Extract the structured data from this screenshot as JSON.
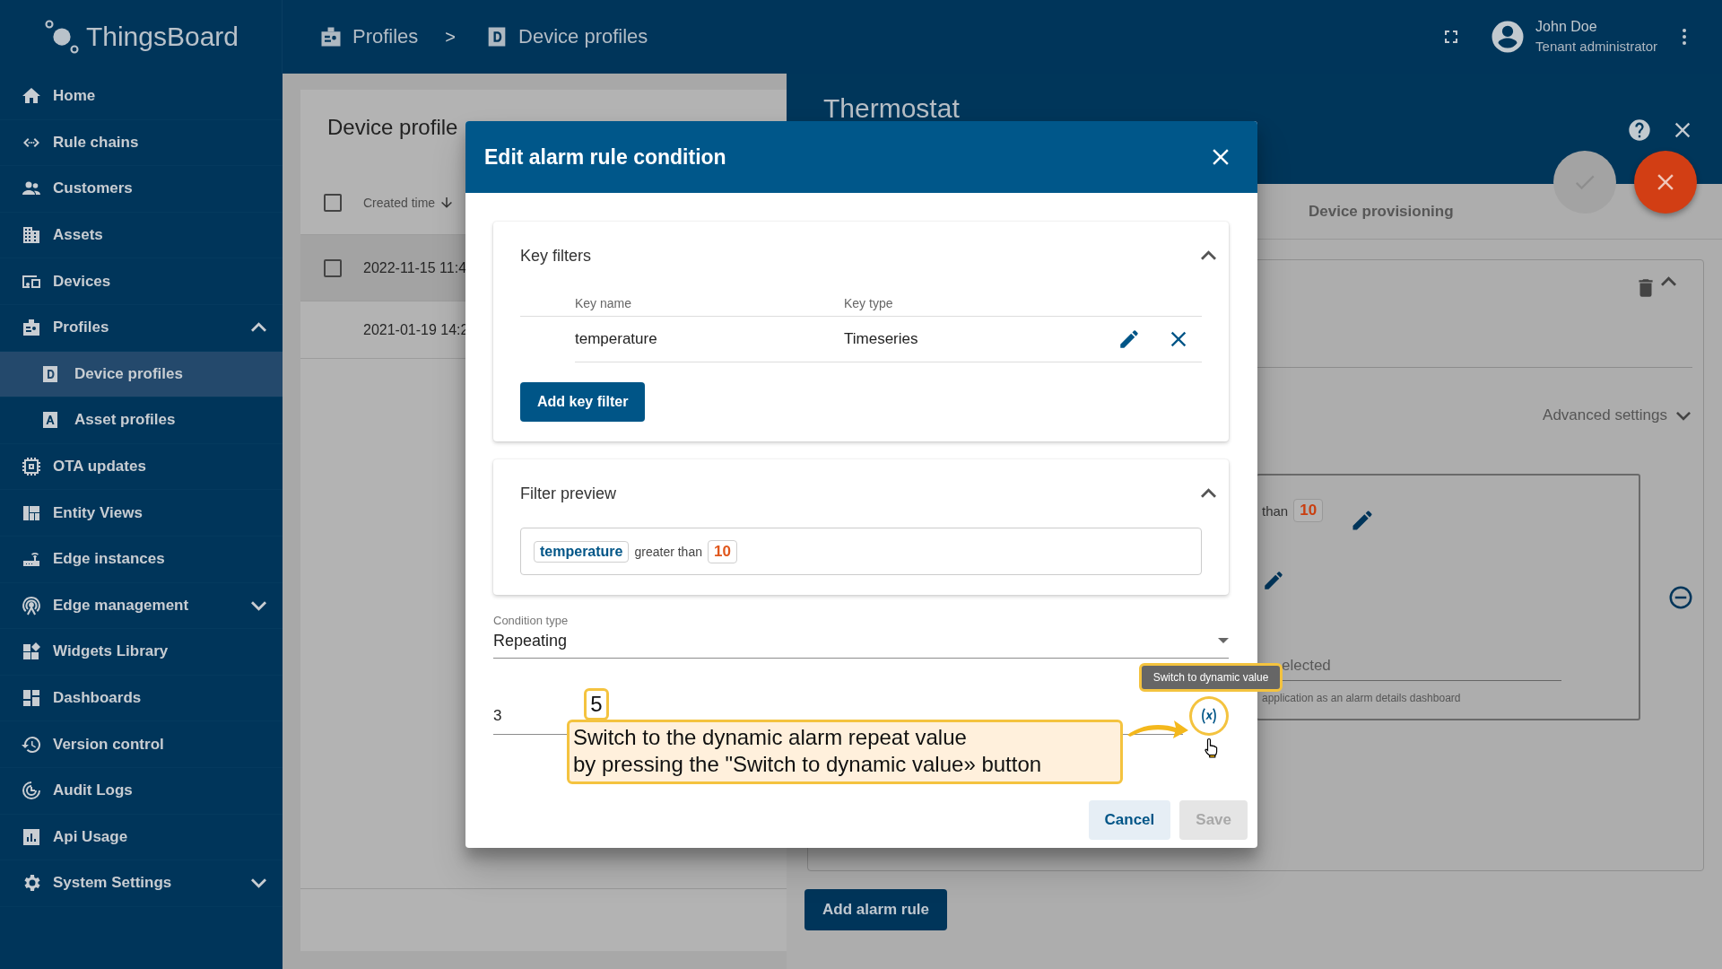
{
  "top_bar": {
    "logo": "ThingsBoard",
    "breadcrumb": [
      {
        "label": "Profiles"
      },
      {
        "label": "Device profiles"
      }
    ],
    "separator": ">",
    "user": {
      "name": "John Doe",
      "role": "Tenant administrator"
    }
  },
  "sidebar": {
    "items": [
      {
        "label": "Home",
        "selected": false
      },
      {
        "label": "Rule chains",
        "selected": false
      },
      {
        "label": "Customers",
        "selected": false
      },
      {
        "label": "Assets",
        "selected": false
      },
      {
        "label": "Devices",
        "selected": false
      },
      {
        "label": "Profiles",
        "selected": false,
        "expanded": true,
        "children": [
          {
            "label": "Device profiles",
            "selected": true
          },
          {
            "label": "Asset profiles",
            "selected": false
          }
        ]
      },
      {
        "label": "OTA updates",
        "selected": false
      },
      {
        "label": "Entity Views",
        "selected": false
      },
      {
        "label": "Edge instances",
        "selected": false
      },
      {
        "label": "Edge management",
        "selected": false,
        "expanded": false
      },
      {
        "label": "Widgets Library",
        "selected": false
      },
      {
        "label": "Dashboards",
        "selected": false
      },
      {
        "label": "Version control",
        "selected": false
      },
      {
        "label": "Audit Logs",
        "selected": false
      },
      {
        "label": "Api Usage",
        "selected": false
      },
      {
        "label": "System Settings",
        "selected": false,
        "expanded": false
      }
    ]
  },
  "list_panel": {
    "title": "Device profile",
    "select_all": {
      "checked": false
    },
    "columns": [
      {
        "label": "Created time"
      }
    ],
    "rows": [
      {
        "cells": [
          "2022-11-15 11:4"
        ],
        "selected": true
      },
      {
        "cells": [
          "2021-01-19 14:2"
        ],
        "selected": false
      }
    ]
  },
  "detail_panel": {
    "title": "Thermostat",
    "tabs": [
      {
        "label": "Device provisioning",
        "selected": false
      }
    ],
    "advanced_settings": "Advanced settings",
    "condition_preview": {
      "operation": "than",
      "value": "10"
    },
    "dashboard_field": {
      "placeholder": "elected",
      "hint": "application as an alarm details dashboard"
    },
    "add_button": "Add alarm rule"
  },
  "dialog": {
    "title": "Edit alarm rule condition",
    "key_filters": {
      "title": "Key filters",
      "expanded": true,
      "columns": [
        "Key name",
        "Key type"
      ],
      "rows": [
        {
          "key_name": "temperature",
          "key_type": "Timeseries"
        }
      ],
      "add_button": "Add key filter"
    },
    "filter_preview": {
      "title": "Filter preview",
      "expanded": true,
      "key": "temperature",
      "operation": "greater than",
      "value": "10"
    },
    "condition_type": {
      "label": "Condition type",
      "value": "Repeating"
    },
    "repeat_count": {
      "value": "3"
    },
    "tooltip": "Switch to dynamic value",
    "buttons": [
      {
        "label": "Cancel",
        "disabled": false
      },
      {
        "label": "Save",
        "disabled": true
      }
    ]
  },
  "annotation": {
    "step": "5",
    "text": "Switch to the dynamic alarm repeat value\nby pressing the \"Switch to dynamic value» button"
  }
}
